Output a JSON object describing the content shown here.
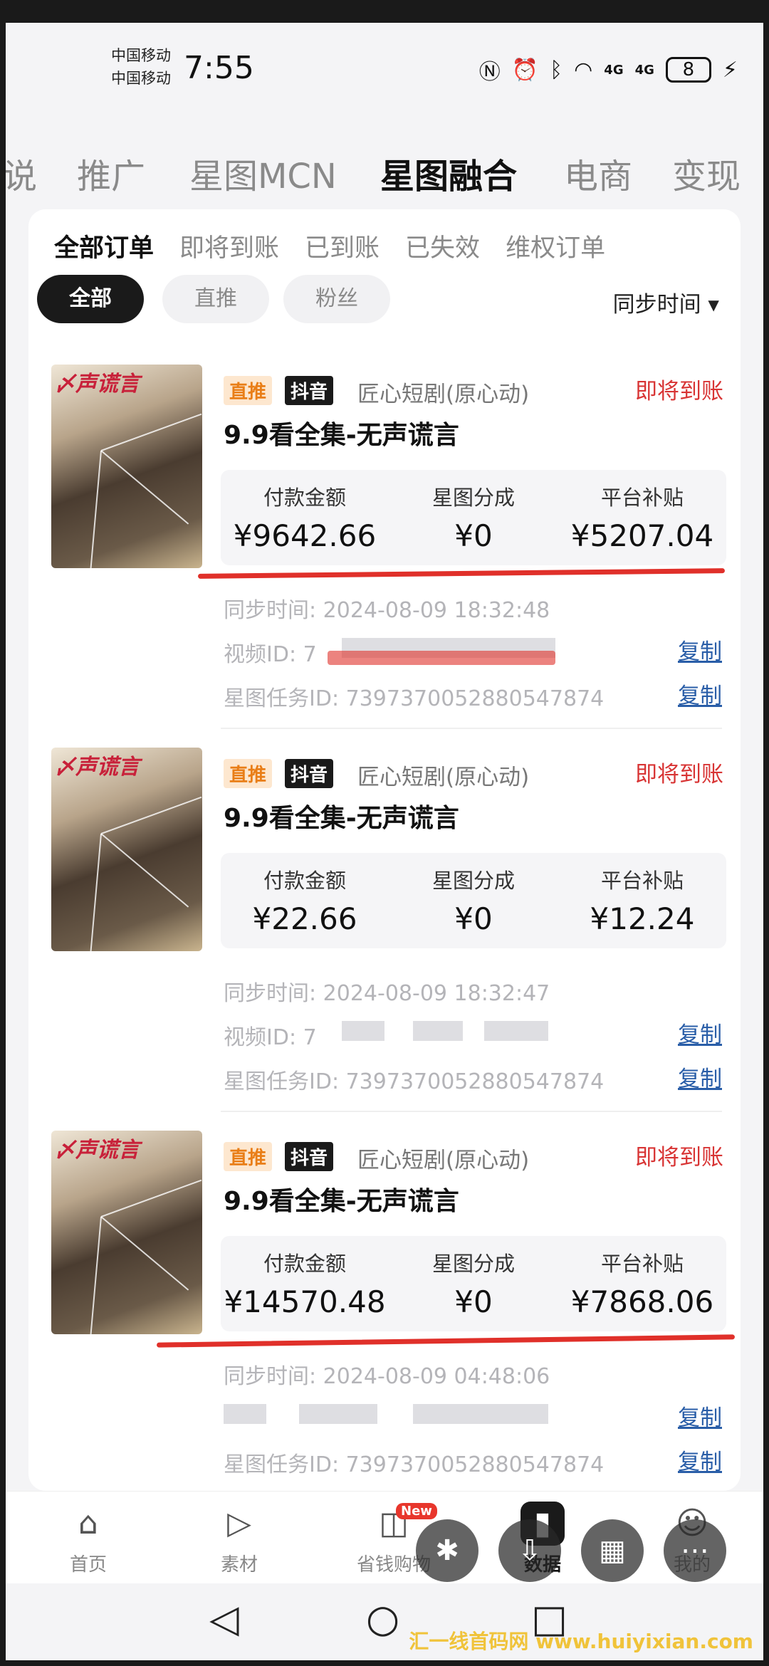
{
  "status_bar": {
    "carrier1": "中国移动",
    "carrier2": "中国移动",
    "time": "7:55",
    "signal_label": "4G",
    "battery": "8"
  },
  "top_tabs": [
    "说",
    "推广",
    "星图MCN",
    "星图融合",
    "电商",
    "变现"
  ],
  "sub_tabs": [
    "全部订单",
    "即将到账",
    "已到账",
    "已失效",
    "维权订单"
  ],
  "chips": [
    "全部",
    "直推",
    "粉丝"
  ],
  "sync_select": "同步时间 ▾",
  "amount_labels": {
    "pay": "付款金额",
    "share": "星图分成",
    "subsidy": "平台补贴"
  },
  "orders": [
    {
      "tag_type": "直推",
      "tag_platform": "抖音",
      "shop": "匠心短剧(原心动)",
      "state": "即将到账",
      "title": "9.9看全集-无声谎言",
      "pay": "¥9642.66",
      "share": "¥0",
      "subsidy": "¥5207.04",
      "sync_time": "同步时间: 2024-08-09 18:32:48",
      "video_id_label": "视频ID: 7",
      "task_id": "星图任务ID: 7397370052880547874",
      "copy1": "复制",
      "copy2": "复制"
    },
    {
      "tag_type": "直推",
      "tag_platform": "抖音",
      "shop": "匠心短剧(原心动)",
      "state": "即将到账",
      "title": "9.9看全集-无声谎言",
      "pay": "¥22.66",
      "share": "¥0",
      "subsidy": "¥12.24",
      "sync_time": "同步时间: 2024-08-09 18:32:47",
      "video_id_label": "视频ID: 7",
      "task_id": "星图任务ID: 7397370052880547874",
      "copy1": "复制",
      "copy2": "复制"
    },
    {
      "tag_type": "直推",
      "tag_platform": "抖音",
      "shop": "匠心短剧(原心动)",
      "state": "即将到账",
      "title": "9.9看全集-无声谎言",
      "pay": "¥14570.48",
      "share": "¥0",
      "subsidy": "¥7868.06",
      "sync_time": "同步时间: 2024-08-09 04:48:06",
      "video_id_label": "",
      "task_id": "星图任务ID: 7397370052880547874",
      "copy1": "复制",
      "copy2": "复制"
    }
  ],
  "bottom_nav": [
    {
      "label": "首页",
      "icon": "home-icon"
    },
    {
      "label": "素材",
      "icon": "play-icon"
    },
    {
      "label": "省钱购物",
      "icon": "shopping-bag-icon",
      "badge": "New"
    },
    {
      "label": "数据",
      "icon": "bar-chart-icon"
    },
    {
      "label": "我的",
      "icon": "user-icon"
    }
  ],
  "watermark": "汇一线首码网 www.huiyixian.com",
  "colors": {
    "accent_red": "#d83434",
    "tag_orange": "#e97e17",
    "link_blue": "#2a5ea8",
    "annotation_red": "#e0302a"
  }
}
